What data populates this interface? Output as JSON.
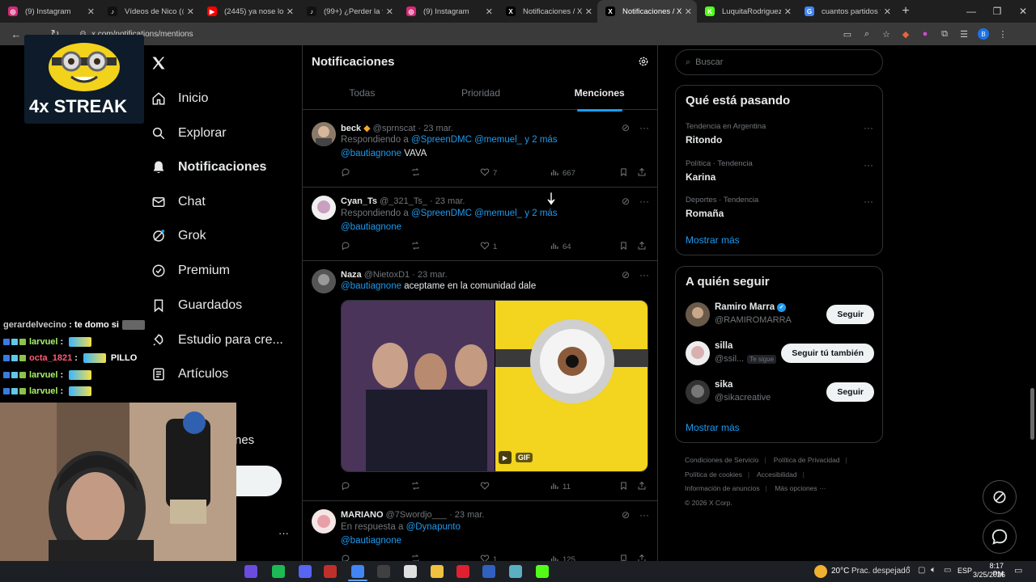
{
  "browser": {
    "tabs": [
      {
        "label": "(9) Instagram",
        "color": "#d62976",
        "glyph": "◎"
      },
      {
        "label": "Vídeos de Nico (@nic",
        "color": "#111111",
        "glyph": "♪"
      },
      {
        "label": "(2445) ya nose lo que",
        "color": "#ff0000",
        "glyph": "▶"
      },
      {
        "label": "(99+) ¿Perder la final",
        "color": "#111111",
        "glyph": "♪"
      },
      {
        "label": "(9) Instagram",
        "color": "#d62976",
        "glyph": "◎"
      },
      {
        "label": "Notificaciones / X",
        "color": "#000000",
        "glyph": "X"
      },
      {
        "label": "Notificaciones / X",
        "color": "#000000",
        "glyph": "X",
        "active": true
      },
      {
        "label": "LuquitaRodriguez Str",
        "color": "#53fc18",
        "glyph": "K"
      },
      {
        "label": "cuantos partidos talle",
        "color": "#4285f4",
        "glyph": "G"
      }
    ],
    "url": "x.com/notifications/mentions"
  },
  "nav": {
    "items": [
      {
        "label": "Inicio",
        "icon": "home-icon"
      },
      {
        "label": "Explorar",
        "icon": "search-icon"
      },
      {
        "label": "Notificaciones",
        "icon": "bell-icon"
      },
      {
        "label": "Chat",
        "icon": "mail-icon"
      },
      {
        "label": "Grok",
        "icon": "grok-icon"
      },
      {
        "label": "Premium",
        "icon": "verified-icon"
      },
      {
        "label": "Guardados",
        "icon": "bookmark-icon"
      },
      {
        "label": "Estudio para cre...",
        "icon": "rocket-icon"
      },
      {
        "label": "Artículos",
        "icon": "article-icon"
      }
    ],
    "partial_label": "nes",
    "more_label": "···"
  },
  "overlay": {
    "streak_text": "4x STREAK",
    "chat": [
      {
        "user": "gerardelvecino",
        "msg": "te domo si",
        "color": "#c9c9c9"
      },
      {
        "user": "larvuel",
        "msg": "",
        "color": "#a8f06c"
      },
      {
        "user": "octa_1821",
        "msg": "PILLO",
        "color": "#ff5a7a"
      },
      {
        "user": "larvuel",
        "msg": "",
        "color": "#a8f06c"
      },
      {
        "user": "larvuel",
        "msg": "",
        "color": "#a8f06c"
      }
    ]
  },
  "main": {
    "title": "Notificaciones",
    "tabs": [
      "Todas",
      "Prioridad",
      "Menciones"
    ],
    "tweets": [
      {
        "name": "beck",
        "handle": "@sprnscat",
        "date": "23 mar.",
        "reply_prefix": "Respondiendo a",
        "reply_to": "@SpreenDMC @memuel_ y 2 más",
        "mention": "@bautiagnone",
        "text": "VAVA",
        "likes": "7",
        "views": "667"
      },
      {
        "name": "Cyan_Ts",
        "handle": "@_321_Ts_",
        "date": "23 mar.",
        "reply_prefix": "Respondiendo a",
        "reply_to": "@SpreenDMC @memuel_ y 2 más",
        "mention": "@bautiagnone",
        "text": "",
        "likes": "1",
        "views": "64"
      },
      {
        "name": "Naza",
        "handle": "@NietoxD1",
        "date": "23 mar.",
        "mention": "@bautiagnone",
        "text": "aceptame en la comunidad dale",
        "gif_label": "GIF",
        "likes": "",
        "views": "11"
      },
      {
        "name": "MARIANO",
        "handle": "@7Swordjo___",
        "date": "23 mar.",
        "reply_prefix": "En respuesta a",
        "reply_to": "@Dynapunto",
        "mention": "@bautiagnone",
        "likes": "1",
        "views": "125"
      }
    ]
  },
  "right": {
    "search_placeholder": "Buscar",
    "trends_title": "Qué está pasando",
    "trends": [
      {
        "meta": "Tendencia en Argentina",
        "name": "Ritondo"
      },
      {
        "meta": "Política · Tendencia",
        "name": "Karina"
      },
      {
        "meta": "Deportes · Tendencia",
        "name": "Romaña"
      }
    ],
    "show_more": "Mostrar más",
    "follow_title": "A quién seguir",
    "follow": [
      {
        "name": "Ramiro Marra",
        "handle": "@RAMIROMARRA",
        "verified": true,
        "button": "Seguir"
      },
      {
        "name": "silla",
        "handle": "@ssil...",
        "tag": "Te sigue",
        "button": "Seguir tú también"
      },
      {
        "name": "sika",
        "handle": "@sikacreative",
        "button": "Seguir"
      }
    ],
    "footer": {
      "links": [
        "Condiciones de Servicio",
        "Política de Privacidad",
        "Política de cookies",
        "Accesibilidad",
        "Información de anuncios",
        "Más opciones ···"
      ],
      "copyright": "© 2026 X Corp."
    }
  },
  "taskbar": {
    "weather": "20°C",
    "weather_desc": "Prac. despejado",
    "lang": "ESP",
    "time": "8:17 PM",
    "date": "3/25/2026"
  }
}
